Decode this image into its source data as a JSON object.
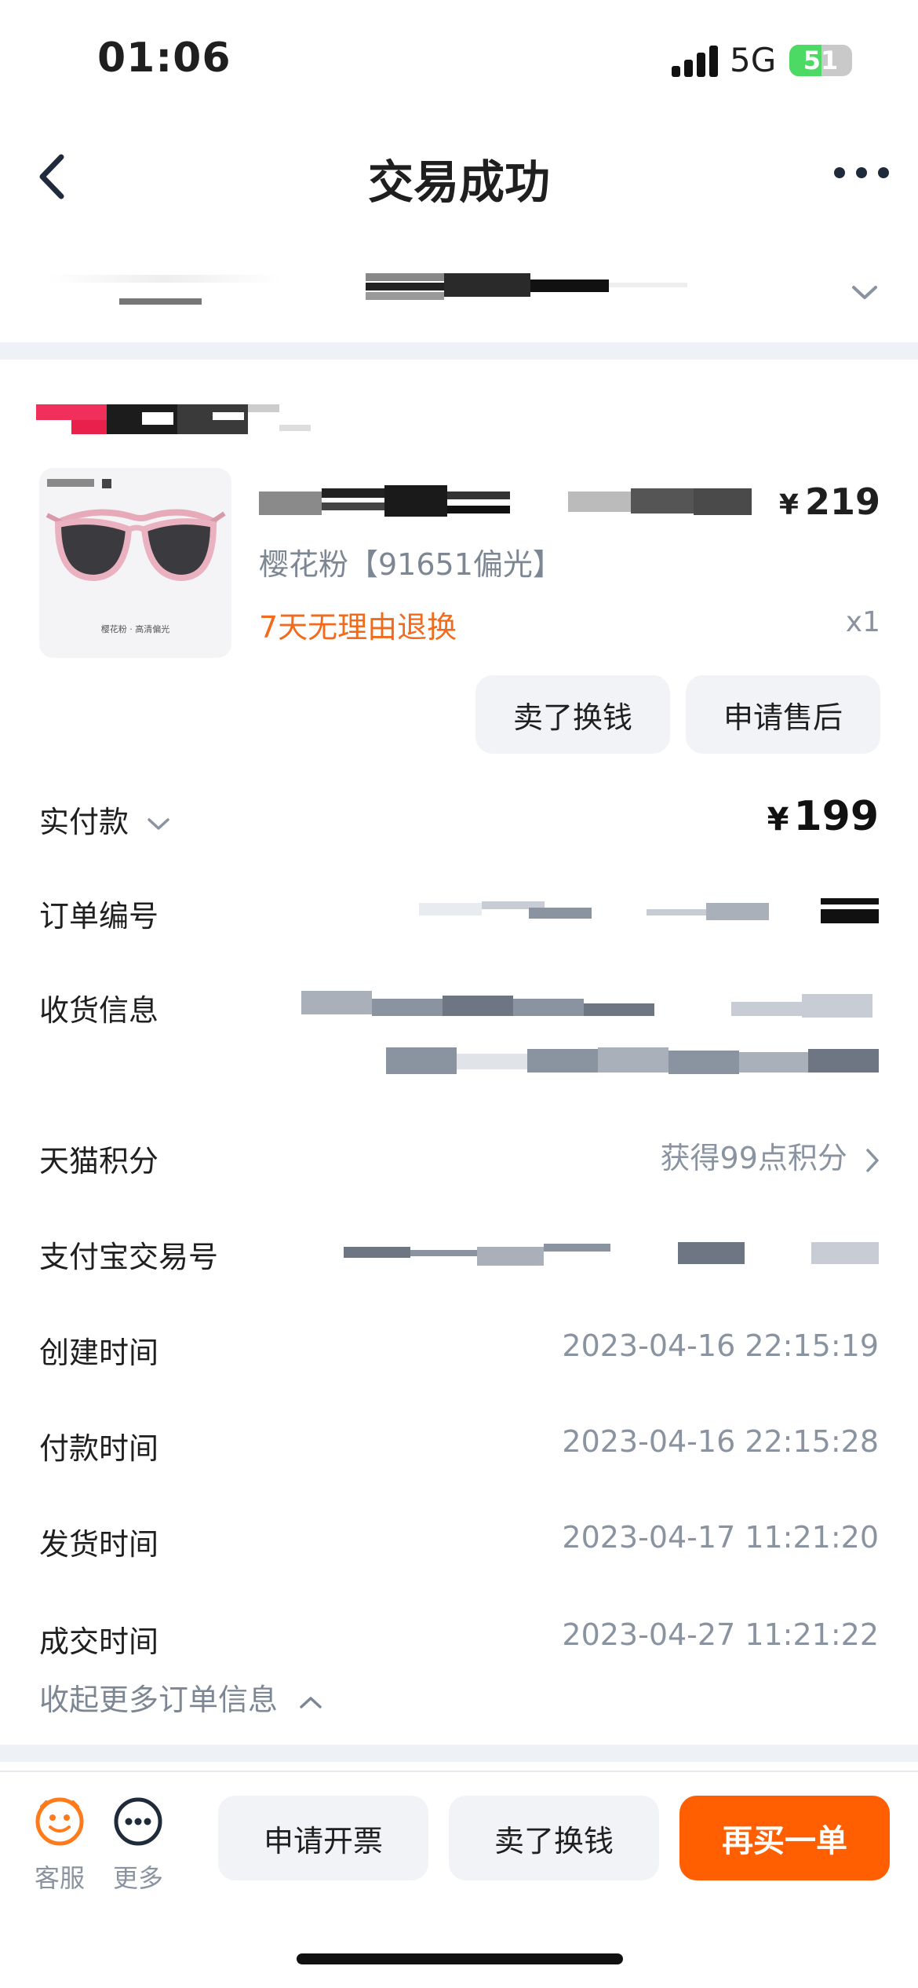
{
  "status_bar": {
    "time": "01:06",
    "network": "5G",
    "battery": "51",
    "battery_level": 0.51
  },
  "nav": {
    "title": "交易成功"
  },
  "product": {
    "price_currency": "¥",
    "price": "219",
    "sku": "樱花粉【91651偏光】",
    "tag": "7天无理由退换",
    "qty": "x1",
    "image_caption": "樱花粉 · 高清偏光",
    "actions": [
      "卖了换钱",
      "申请售后"
    ]
  },
  "order": {
    "paid_label": "实付款",
    "paid_currency": "¥",
    "paid_amount": "199",
    "order_no_label": "订单编号",
    "shipping_label": "收货信息",
    "points_label": "天猫积分",
    "points_value": "获得99点积分",
    "alipay_label": "支付宝交易号",
    "created_label": "创建时间",
    "created_value": "2023-04-16 22:15:19",
    "paid_time_label": "付款时间",
    "paid_time_value": "2023-04-16 22:15:28",
    "shipped_label": "发货时间",
    "shipped_value": "2023-04-17 11:21:20",
    "deal_label": "成交时间",
    "deal_value": "2023-04-27 11:21:22",
    "collapse_label": "收起更多订单信息"
  },
  "bottom_bar": {
    "service_label": "客服",
    "more_label": "更多",
    "invoice_label": "申请开票",
    "sell_label": "卖了换钱",
    "rebuy_label": "再买一单"
  },
  "colors": {
    "accent": "#ff5f00",
    "tag_orange": "#f26a1b",
    "muted_text": "#8a93a0",
    "divider": "#eef2f6",
    "pill_bg": "#f1f3f6"
  }
}
